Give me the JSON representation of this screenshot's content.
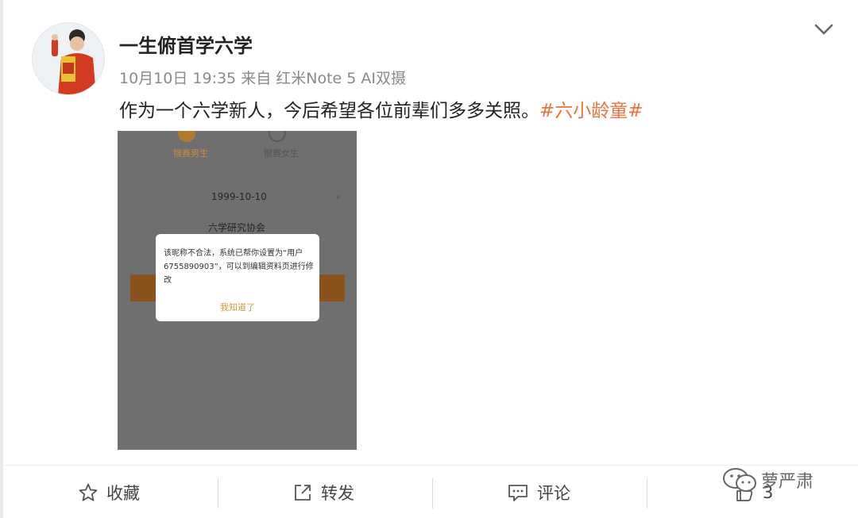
{
  "post": {
    "author": "一生俯首学六学",
    "meta": "10月10日 19:35 来自 红米Note 5 AI双摄",
    "text": "作为一个六学新人，今后希望各位前辈们多多关照。",
    "tag": "#六小龄童#"
  },
  "screenshot": {
    "gender_male": "猴赛男生",
    "gender_female": "猴赛女生",
    "date": "1999-10-10",
    "org": "六学研究协会",
    "dialog_message": "该昵称不合法，系统已帮你设置为“用户6755890903”，可以到编辑资料页进行修改",
    "dialog_ok": "我知道了"
  },
  "actions": {
    "favorite": "收藏",
    "repost": "转发",
    "comment": "评论",
    "like_count": "3"
  },
  "watermark": "萝严肃",
  "colors": {
    "tag": "#eb7340",
    "accent_orange": "#d9953d"
  },
  "icons": [
    "chevron-down-icon",
    "star-icon",
    "share-icon",
    "comment-icon",
    "thumb-up-icon",
    "wechat-icon"
  ]
}
